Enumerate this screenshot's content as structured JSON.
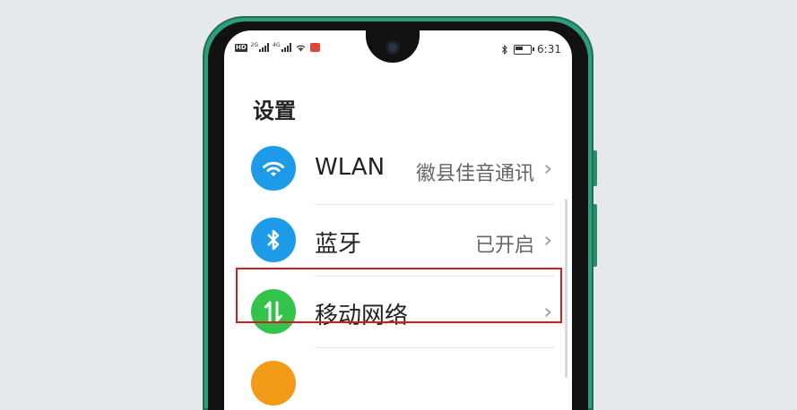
{
  "status": {
    "time": "6:31",
    "network_badge": "HD",
    "sim1_type": "2G",
    "sim2_type": "4G"
  },
  "page": {
    "title": "设置"
  },
  "items": [
    {
      "label": "WLAN",
      "value": "徽县佳音通讯",
      "icon": "wifi-icon",
      "color": "#1e9be8"
    },
    {
      "label": "蓝牙",
      "value": "已开启",
      "icon": "bluetooth-icon",
      "color": "#1e9be8"
    },
    {
      "label": "移动网络",
      "value": "",
      "icon": "mobile-data-icon",
      "color": "#33c24a"
    },
    {
      "label": "",
      "value": "",
      "icon": "partial-icon",
      "color": "#f39a18"
    }
  ],
  "highlight_color": "#cc1f1f"
}
